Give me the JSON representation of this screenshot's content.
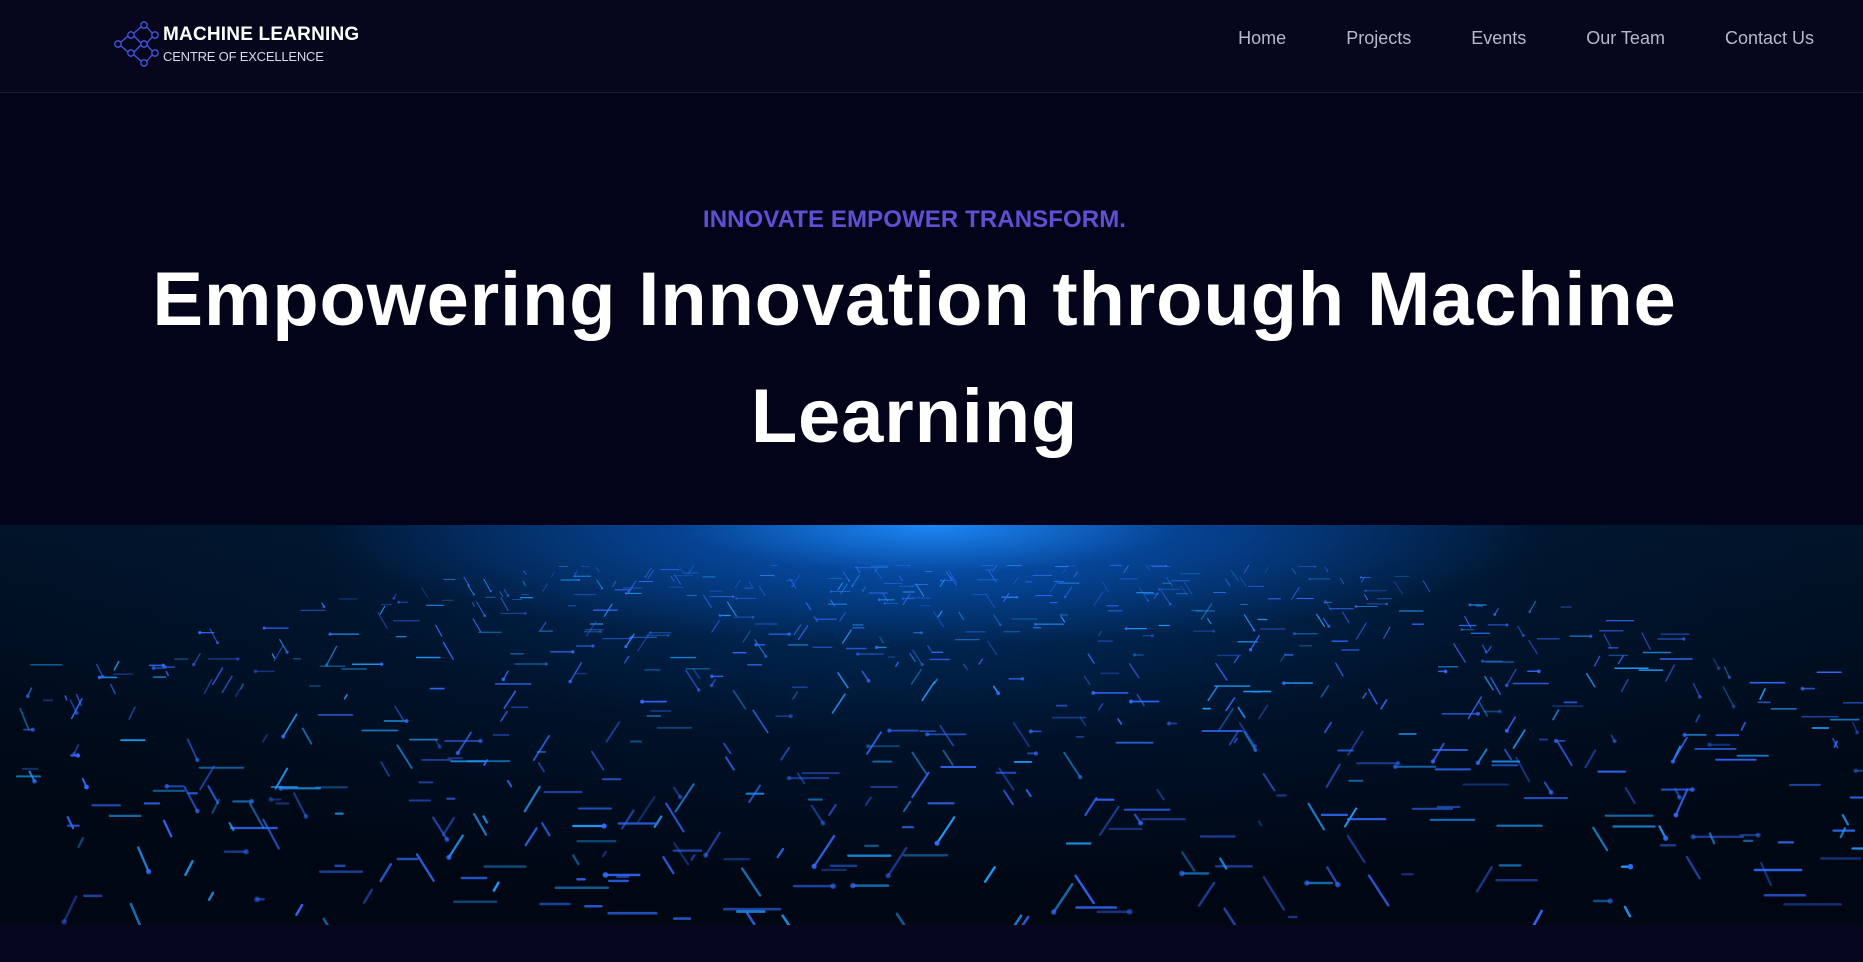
{
  "brand": {
    "title": "MACHINE LEARNING",
    "subtitle": "CENTRE OF EXCELLENCE",
    "icon": "neural-network-logo"
  },
  "nav": {
    "items": [
      {
        "label": "Home"
      },
      {
        "label": "Projects"
      },
      {
        "label": "Events"
      },
      {
        "label": "Our Team"
      },
      {
        "label": "Contact Us"
      }
    ]
  },
  "hero": {
    "tagline": "INNOVATE EMPOWER TRANSFORM.",
    "headline": "Empowering Innovation through Machine Learning"
  },
  "colors": {
    "background": "#04041a",
    "tagline": "#5e4fd3",
    "nav_text": "#b8b9c8",
    "circuit_glow": "#1e8cff",
    "circuit_trace": "#2f6cff"
  }
}
